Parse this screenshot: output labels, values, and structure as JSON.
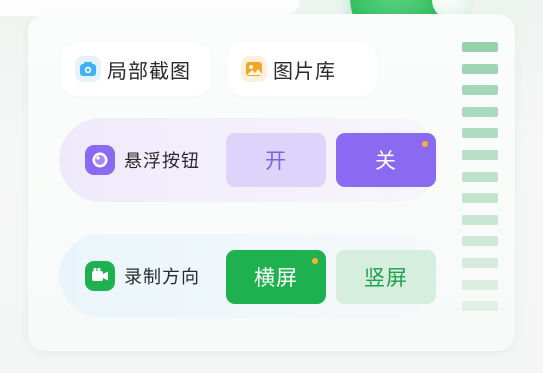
{
  "shortcuts": {
    "partial_screenshot": {
      "label": "局部截图",
      "icon": "camera-icon",
      "color": "#3fb0f0"
    },
    "gallery": {
      "label": "图片库",
      "icon": "picture-icon",
      "color": "#f6a623"
    }
  },
  "floating_button": {
    "label": "悬浮按钮",
    "icon": "floating-ball-icon",
    "on_label": "开",
    "off_label": "关",
    "selected": "关",
    "accent": "#8a6af0"
  },
  "record_direction": {
    "label": "录制方向",
    "icon": "video-camera-icon",
    "landscape_label": "横屏",
    "portrait_label": "竖屏",
    "selected": "横屏",
    "accent": "#1fb14f"
  },
  "colors": {
    "indicator_dot": "#ffb02e",
    "green_orb": "#37c063"
  }
}
